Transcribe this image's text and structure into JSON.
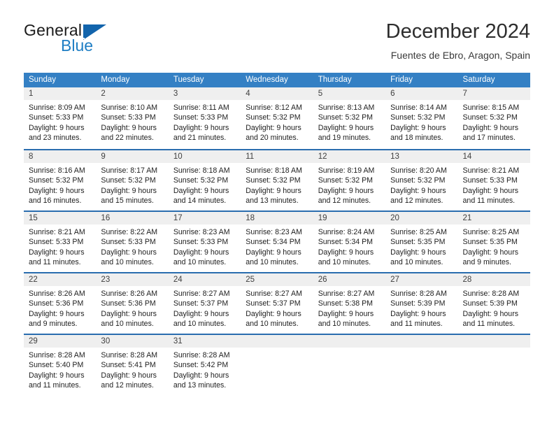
{
  "brand": {
    "name_top": "General",
    "name_bottom": "Blue",
    "triangle_icon": "triangle-logo-icon",
    "color_dark": "#1b1b1b",
    "color_blue": "#1f7ec4"
  },
  "header": {
    "title": "December 2024",
    "subtitle": "Fuentes de Ebro, Aragon, Spain"
  },
  "theme": {
    "header_band": "#3480c4",
    "row_divider": "#2a6daf",
    "day_band": "#efefef",
    "text": "#1e1e1e"
  },
  "weekdays": [
    "Sunday",
    "Monday",
    "Tuesday",
    "Wednesday",
    "Thursday",
    "Friday",
    "Saturday"
  ],
  "weeks": [
    [
      {
        "day": "1",
        "sunrise": "Sunrise: 8:09 AM",
        "sunset": "Sunset: 5:33 PM",
        "daylight1": "Daylight: 9 hours",
        "daylight2": "and 23 minutes."
      },
      {
        "day": "2",
        "sunrise": "Sunrise: 8:10 AM",
        "sunset": "Sunset: 5:33 PM",
        "daylight1": "Daylight: 9 hours",
        "daylight2": "and 22 minutes."
      },
      {
        "day": "3",
        "sunrise": "Sunrise: 8:11 AM",
        "sunset": "Sunset: 5:33 PM",
        "daylight1": "Daylight: 9 hours",
        "daylight2": "and 21 minutes."
      },
      {
        "day": "4",
        "sunrise": "Sunrise: 8:12 AM",
        "sunset": "Sunset: 5:32 PM",
        "daylight1": "Daylight: 9 hours",
        "daylight2": "and 20 minutes."
      },
      {
        "day": "5",
        "sunrise": "Sunrise: 8:13 AM",
        "sunset": "Sunset: 5:32 PM",
        "daylight1": "Daylight: 9 hours",
        "daylight2": "and 19 minutes."
      },
      {
        "day": "6",
        "sunrise": "Sunrise: 8:14 AM",
        "sunset": "Sunset: 5:32 PM",
        "daylight1": "Daylight: 9 hours",
        "daylight2": "and 18 minutes."
      },
      {
        "day": "7",
        "sunrise": "Sunrise: 8:15 AM",
        "sunset": "Sunset: 5:32 PM",
        "daylight1": "Daylight: 9 hours",
        "daylight2": "and 17 minutes."
      }
    ],
    [
      {
        "day": "8",
        "sunrise": "Sunrise: 8:16 AM",
        "sunset": "Sunset: 5:32 PM",
        "daylight1": "Daylight: 9 hours",
        "daylight2": "and 16 minutes."
      },
      {
        "day": "9",
        "sunrise": "Sunrise: 8:17 AM",
        "sunset": "Sunset: 5:32 PM",
        "daylight1": "Daylight: 9 hours",
        "daylight2": "and 15 minutes."
      },
      {
        "day": "10",
        "sunrise": "Sunrise: 8:18 AM",
        "sunset": "Sunset: 5:32 PM",
        "daylight1": "Daylight: 9 hours",
        "daylight2": "and 14 minutes."
      },
      {
        "day": "11",
        "sunrise": "Sunrise: 8:18 AM",
        "sunset": "Sunset: 5:32 PM",
        "daylight1": "Daylight: 9 hours",
        "daylight2": "and 13 minutes."
      },
      {
        "day": "12",
        "sunrise": "Sunrise: 8:19 AM",
        "sunset": "Sunset: 5:32 PM",
        "daylight1": "Daylight: 9 hours",
        "daylight2": "and 12 minutes."
      },
      {
        "day": "13",
        "sunrise": "Sunrise: 8:20 AM",
        "sunset": "Sunset: 5:32 PM",
        "daylight1": "Daylight: 9 hours",
        "daylight2": "and 12 minutes."
      },
      {
        "day": "14",
        "sunrise": "Sunrise: 8:21 AM",
        "sunset": "Sunset: 5:33 PM",
        "daylight1": "Daylight: 9 hours",
        "daylight2": "and 11 minutes."
      }
    ],
    [
      {
        "day": "15",
        "sunrise": "Sunrise: 8:21 AM",
        "sunset": "Sunset: 5:33 PM",
        "daylight1": "Daylight: 9 hours",
        "daylight2": "and 11 minutes."
      },
      {
        "day": "16",
        "sunrise": "Sunrise: 8:22 AM",
        "sunset": "Sunset: 5:33 PM",
        "daylight1": "Daylight: 9 hours",
        "daylight2": "and 10 minutes."
      },
      {
        "day": "17",
        "sunrise": "Sunrise: 8:23 AM",
        "sunset": "Sunset: 5:33 PM",
        "daylight1": "Daylight: 9 hours",
        "daylight2": "and 10 minutes."
      },
      {
        "day": "18",
        "sunrise": "Sunrise: 8:23 AM",
        "sunset": "Sunset: 5:34 PM",
        "daylight1": "Daylight: 9 hours",
        "daylight2": "and 10 minutes."
      },
      {
        "day": "19",
        "sunrise": "Sunrise: 8:24 AM",
        "sunset": "Sunset: 5:34 PM",
        "daylight1": "Daylight: 9 hours",
        "daylight2": "and 10 minutes."
      },
      {
        "day": "20",
        "sunrise": "Sunrise: 8:25 AM",
        "sunset": "Sunset: 5:35 PM",
        "daylight1": "Daylight: 9 hours",
        "daylight2": "and 10 minutes."
      },
      {
        "day": "21",
        "sunrise": "Sunrise: 8:25 AM",
        "sunset": "Sunset: 5:35 PM",
        "daylight1": "Daylight: 9 hours",
        "daylight2": "and 9 minutes."
      }
    ],
    [
      {
        "day": "22",
        "sunrise": "Sunrise: 8:26 AM",
        "sunset": "Sunset: 5:36 PM",
        "daylight1": "Daylight: 9 hours",
        "daylight2": "and 9 minutes."
      },
      {
        "day": "23",
        "sunrise": "Sunrise: 8:26 AM",
        "sunset": "Sunset: 5:36 PM",
        "daylight1": "Daylight: 9 hours",
        "daylight2": "and 10 minutes."
      },
      {
        "day": "24",
        "sunrise": "Sunrise: 8:27 AM",
        "sunset": "Sunset: 5:37 PM",
        "daylight1": "Daylight: 9 hours",
        "daylight2": "and 10 minutes."
      },
      {
        "day": "25",
        "sunrise": "Sunrise: 8:27 AM",
        "sunset": "Sunset: 5:37 PM",
        "daylight1": "Daylight: 9 hours",
        "daylight2": "and 10 minutes."
      },
      {
        "day": "26",
        "sunrise": "Sunrise: 8:27 AM",
        "sunset": "Sunset: 5:38 PM",
        "daylight1": "Daylight: 9 hours",
        "daylight2": "and 10 minutes."
      },
      {
        "day": "27",
        "sunrise": "Sunrise: 8:28 AM",
        "sunset": "Sunset: 5:39 PM",
        "daylight1": "Daylight: 9 hours",
        "daylight2": "and 11 minutes."
      },
      {
        "day": "28",
        "sunrise": "Sunrise: 8:28 AM",
        "sunset": "Sunset: 5:39 PM",
        "daylight1": "Daylight: 9 hours",
        "daylight2": "and 11 minutes."
      }
    ],
    [
      {
        "day": "29",
        "sunrise": "Sunrise: 8:28 AM",
        "sunset": "Sunset: 5:40 PM",
        "daylight1": "Daylight: 9 hours",
        "daylight2": "and 11 minutes."
      },
      {
        "day": "30",
        "sunrise": "Sunrise: 8:28 AM",
        "sunset": "Sunset: 5:41 PM",
        "daylight1": "Daylight: 9 hours",
        "daylight2": "and 12 minutes."
      },
      {
        "day": "31",
        "sunrise": "Sunrise: 8:28 AM",
        "sunset": "Sunset: 5:42 PM",
        "daylight1": "Daylight: 9 hours",
        "daylight2": "and 13 minutes."
      },
      {
        "day": "",
        "sunrise": "",
        "sunset": "",
        "daylight1": "",
        "daylight2": ""
      },
      {
        "day": "",
        "sunrise": "",
        "sunset": "",
        "daylight1": "",
        "daylight2": ""
      },
      {
        "day": "",
        "sunrise": "",
        "sunset": "",
        "daylight1": "",
        "daylight2": ""
      },
      {
        "day": "",
        "sunrise": "",
        "sunset": "",
        "daylight1": "",
        "daylight2": ""
      }
    ]
  ]
}
